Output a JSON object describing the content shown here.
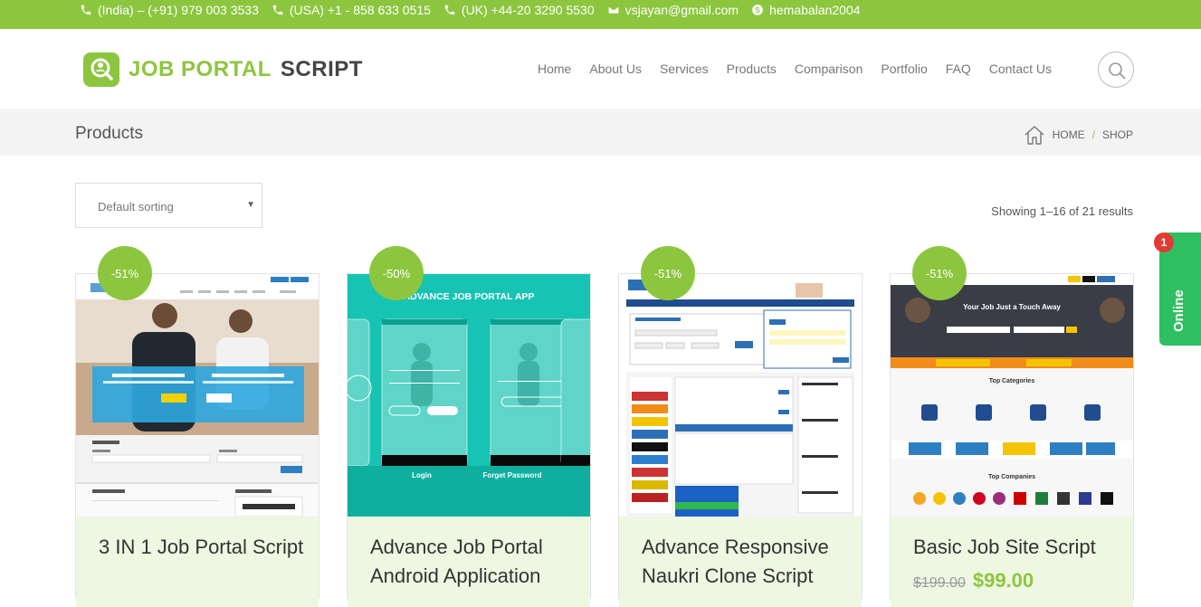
{
  "topbar": {
    "india": "(India) – (+91) 979 003 3533",
    "usa": "(USA) +1 - 858 633 0515",
    "uk": "(UK) +44-20 3290 5530",
    "email": "vsjayan@gmail.com",
    "skype": "hemabalan2004"
  },
  "logo": {
    "part1": "JOB PORTAL",
    "part2": "SCRIPT"
  },
  "nav": [
    "Home",
    "About Us",
    "Services",
    "Products",
    "Comparison",
    "Portfolio",
    "FAQ",
    "Contact Us"
  ],
  "page": {
    "title": "Products"
  },
  "breadcrumb": {
    "home": "HOME",
    "sep": "/",
    "current": "SHOP"
  },
  "sorting": {
    "selected": "Default sorting"
  },
  "results": "Showing 1–16 of 21 results",
  "products": [
    {
      "name": "3 IN 1 Job Portal Script",
      "badge": "-51%"
    },
    {
      "name": "Advance Job Portal Android Application",
      "badge": "-50%",
      "banner": "ADVANCE JOB PORTAL APP",
      "login": "Login",
      "forgot": "Forget Password"
    },
    {
      "name": "Advance Responsive Naukri Clone Script",
      "badge": "-51%"
    },
    {
      "name": "Basic Job Site Script",
      "badge": "-51%",
      "old_price": "$199.00",
      "new_price": "$99.00",
      "hero": "Your Job Just a Touch Away",
      "top_categories": "Top Categories",
      "top_companies": "Top Companies"
    }
  ],
  "online_widget": {
    "label": "Online",
    "count": "1"
  },
  "colors": {
    "accent": "#8cc63f",
    "online": "#2fbf63",
    "notify": "#e53935"
  }
}
